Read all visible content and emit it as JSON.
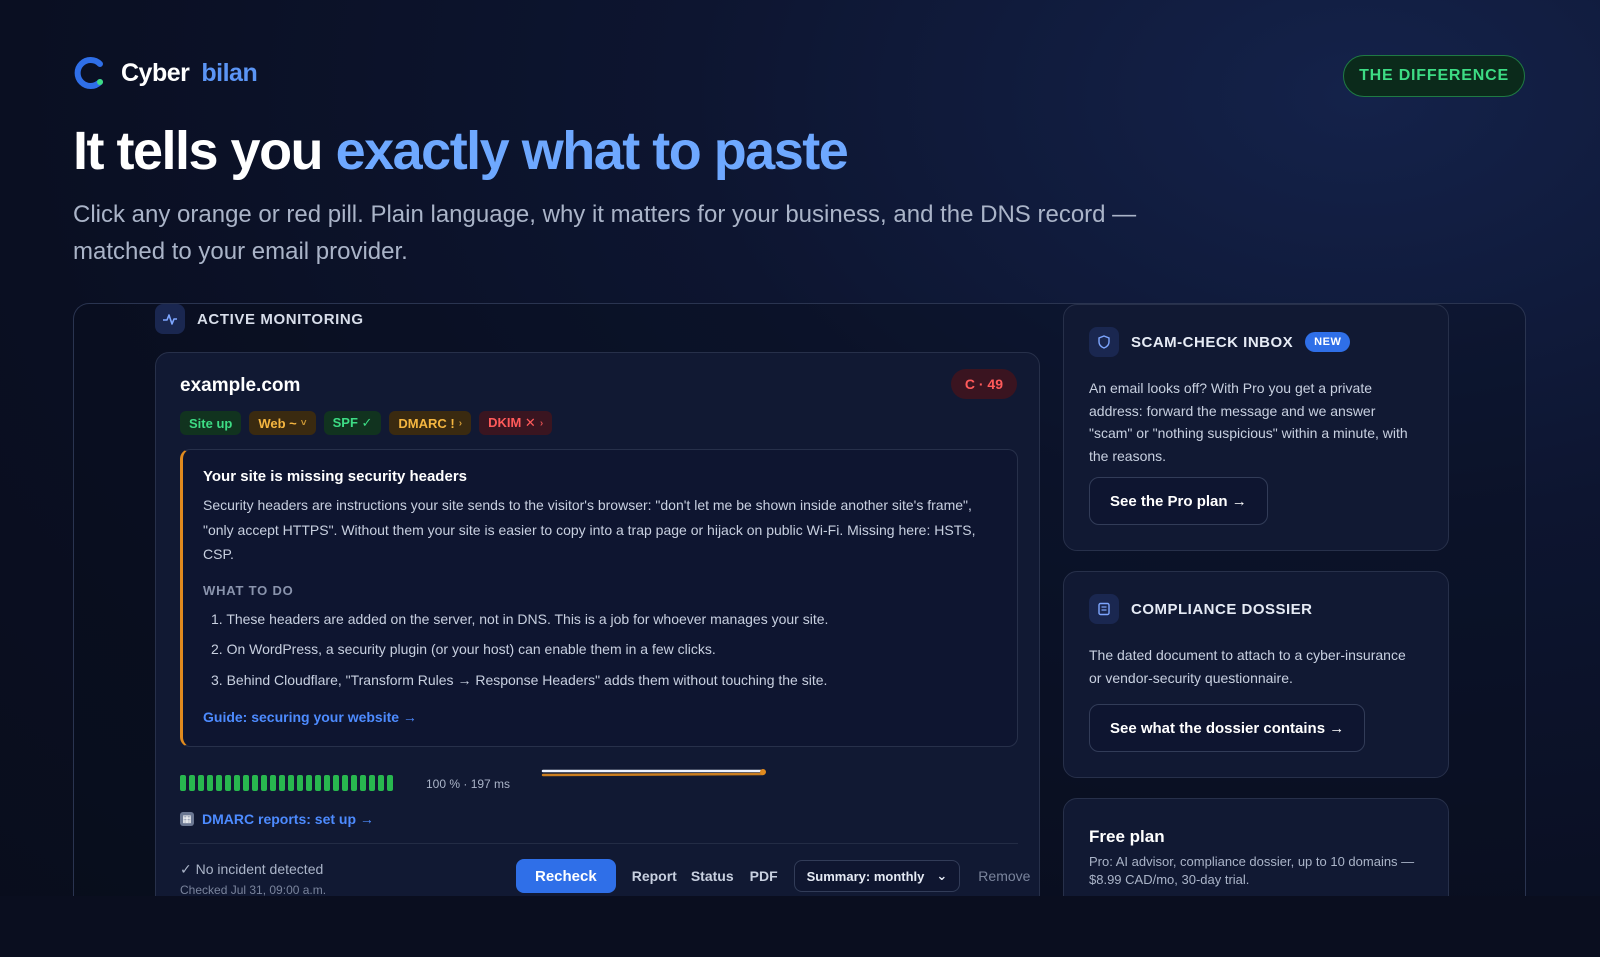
{
  "brand": {
    "name_part1": "Cyber",
    "name_part2": "bilan"
  },
  "badge_top": "THE DIFFERENCE",
  "hero": {
    "title_part1": "It tells you ",
    "title_highlight": "exactly what to paste",
    "subtitle": "Click any orange or red pill. Plain language, why it matters for your business, and the DNS record — matched to your email provider."
  },
  "monitoring": {
    "label": "ACTIVE MONITORING",
    "domain": "example.com",
    "grade": "C · 49",
    "pills": [
      {
        "label": "Site up",
        "status": "ok"
      },
      {
        "label": "Web ~",
        "status": "warn"
      },
      {
        "label": "SPF ✓",
        "status": "ok"
      },
      {
        "label": "DMARC !",
        "status": "warn"
      },
      {
        "label": "DKIM ✕",
        "status": "error"
      }
    ],
    "advice": {
      "title": "Your site is missing security headers",
      "body": "Security headers are instructions your site sends to the visitor's browser: \"don't let me be shown inside another site's frame\", \"only accept HTTPS\". Without them your site is easier to copy into a trap page or hijack on public Wi-Fi. Missing here: HSTS, CSP.",
      "what_to_do_heading": "WHAT TO DO",
      "steps": [
        "1. These headers are added on the server, not in DNS. This is a job for whoever manages your site.",
        "2. On WordPress, a security plugin (or your host) can enable them in a few clicks.",
        "3. Behind Cloudflare, \"Transform Rules → Response Headers\" adds them without touching the site."
      ],
      "guide_link": "Guide: securing your website →"
    },
    "uptime": {
      "text": "100 % · 197 ms",
      "bars": 24,
      "uptime_pct": 100
    },
    "dmarc_link": "DMARC reports: set up →",
    "incident": "✓ No incident detected",
    "checked": "Checked Jul 31, 09:00 a.m.",
    "actions": {
      "recheck": "Recheck",
      "report": "Report",
      "status": "Status",
      "pdf": "PDF",
      "summary_select": "Summary: monthly",
      "remove": "Remove"
    }
  },
  "scam_check": {
    "title": "SCAM-CHECK INBOX",
    "badge": "NEW",
    "body": "An email looks off? With Pro you get a private address: forward the message and we answer \"scam\" or \"nothing suspicious\" within a minute, with the reasons.",
    "button": "See the Pro plan →"
  },
  "compliance": {
    "title": "COMPLIANCE DOSSIER",
    "body": "The dated document to attach to a cyber-insurance or vendor-security questionnaire.",
    "button": "See what the dossier contains →"
  },
  "free_plan": {
    "title": "Free plan",
    "body": "Pro: AI advisor, compliance dossier, up to 10 domains — $8.99 CAD/mo, 30-day trial."
  },
  "colors": {
    "accent": "#6ea8ff",
    "ok": "#3ddc84",
    "warn": "#f5b640",
    "error": "#ff5a5a",
    "primary_button": "#2f6fe8"
  }
}
